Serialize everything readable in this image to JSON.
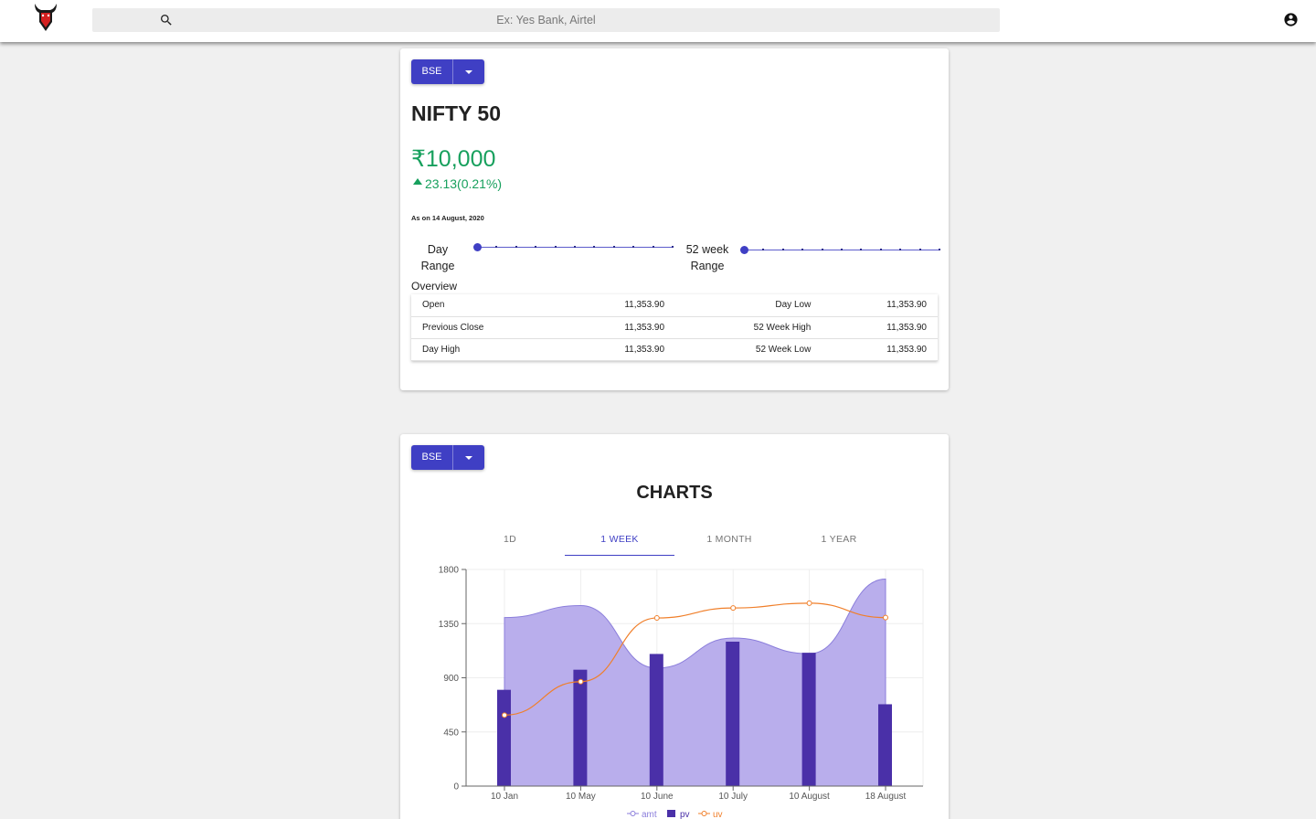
{
  "header": {
    "search_placeholder": "Ex: Yes Bank, Airtel",
    "icons": [
      "bull-logo",
      "search-icon",
      "account-circle-icon"
    ]
  },
  "quote_card": {
    "exchange_button": "BSE",
    "index_name": "NIFTY 50",
    "price": "₹10,000",
    "change": "23.13(0.21%)",
    "as_on": "As on 14 August, 2020",
    "day_range_label": "Day Range",
    "week52_range_label": "52 week Range",
    "day_range_level": 0,
    "week52_range_level": 0,
    "overview_label": "Overview",
    "overview_rows": [
      {
        "label1": "Open",
        "value1": "11,353.90",
        "label2": "Day Low",
        "value2": "11,353.90"
      },
      {
        "label1": "Previous Close",
        "value1": "11,353.90",
        "label2": "52 Week High",
        "value2": "11,353.90"
      },
      {
        "label1": "Day High",
        "value1": "11,353.90",
        "label2": "52 Week Low",
        "value2": "11,353.90"
      }
    ],
    "colors": {
      "accent": "#3f3fc4",
      "positive": "#17a05d"
    }
  },
  "charts_card": {
    "exchange_button": "BSE",
    "title": "CHARTS",
    "tabs": [
      "1D",
      "1 WEEK",
      "1 MONTH",
      "1 YEAR"
    ],
    "active_tab": "1 WEEK"
  },
  "chart_data": {
    "type": "bar",
    "categories": [
      "10 Jan",
      "10 May",
      "10 June",
      "10 July",
      "10 August",
      "18 August"
    ],
    "series": [
      {
        "name": "amt",
        "type": "area",
        "color": "#8b7edb",
        "values": [
          1400,
          1500,
          980,
          1230,
          1100,
          1720
        ]
      },
      {
        "name": "pv",
        "type": "bar",
        "color": "#4a30a8",
        "values": [
          800,
          967,
          1098,
          1200,
          1108,
          680
        ]
      },
      {
        "name": "uv",
        "type": "line",
        "color": "#f07f2a",
        "values": [
          590,
          868,
          1397,
          1480,
          1520,
          1400
        ]
      }
    ],
    "yticks": [
      0,
      450,
      900,
      1350,
      1800
    ],
    "ylim": [
      0,
      1800
    ],
    "grid": true,
    "legend": "bottom-center"
  }
}
